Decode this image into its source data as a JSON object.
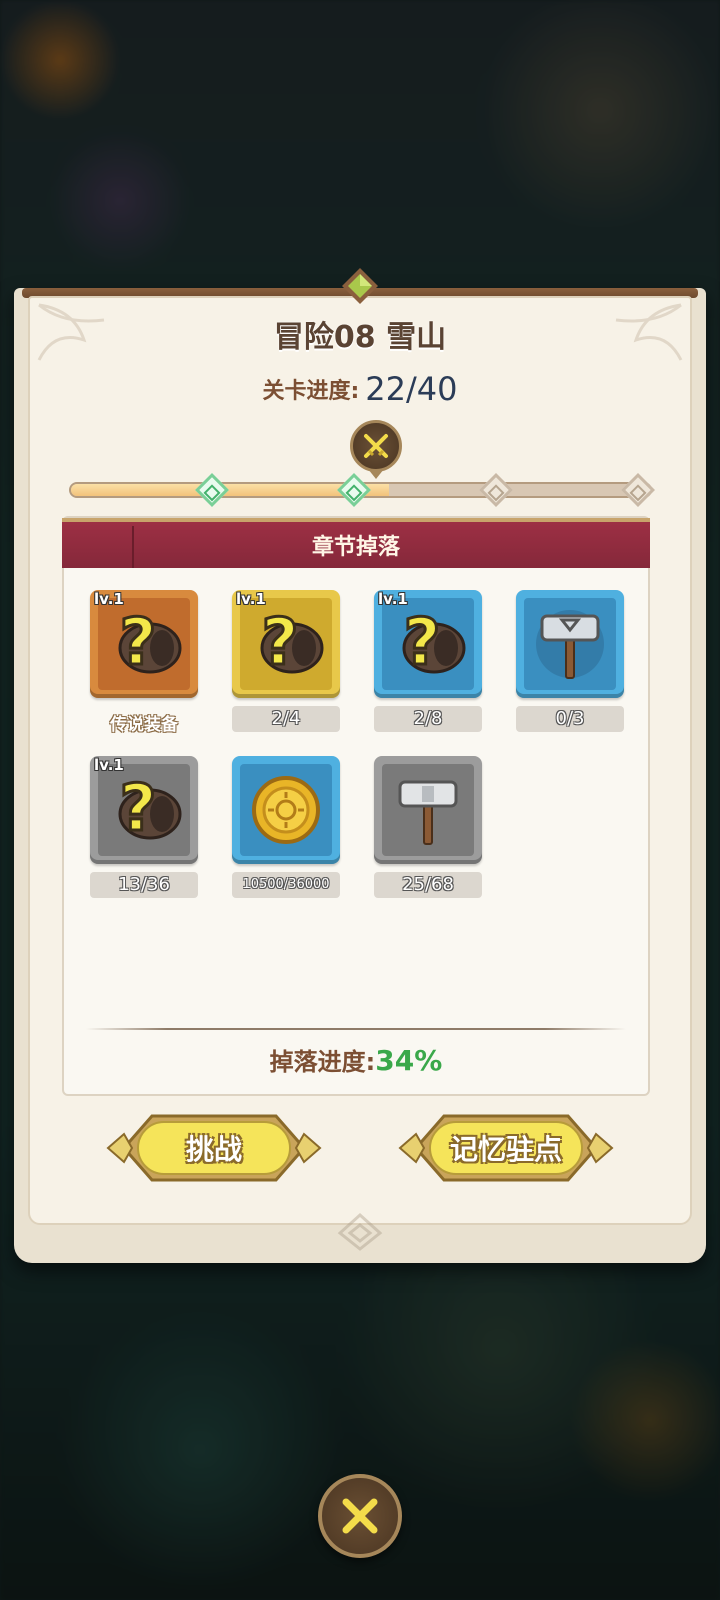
{
  "dialog": {
    "title": "冒险08 雪山",
    "stage_label": "关卡进度:",
    "stage_value": "22/40",
    "stage_progress": 0.55,
    "milestones": [
      {
        "done": true
      },
      {
        "done": true
      },
      {
        "done": false
      },
      {
        "done": false
      }
    ]
  },
  "drops": {
    "header": "章节掉落",
    "items": [
      {
        "icon": "mystery-armor-icon",
        "rarity": "legendary-orange",
        "level": "lv.1",
        "caption": "传说装备"
      },
      {
        "icon": "mystery-armor-icon",
        "rarity": "epic-gold",
        "level": "lv.1",
        "count": "2/4"
      },
      {
        "icon": "mystery-armor-icon",
        "rarity": "rare-blue",
        "level": "lv.1",
        "count": "2/8"
      },
      {
        "icon": "hammer-icon",
        "rarity": "rare-blue",
        "count": "0/3"
      },
      {
        "icon": "mystery-armor-icon",
        "rarity": "common-gray",
        "level": "lv.1",
        "count": "13/36"
      },
      {
        "icon": "gold-coin-icon",
        "rarity": "rare-blue",
        "count": "10500/36000"
      },
      {
        "icon": "hammer-icon",
        "rarity": "common-gray",
        "count": "25/68"
      }
    ],
    "progress_label": "掉落进度:",
    "progress_value": "34%"
  },
  "buttons": {
    "challenge": "挑战",
    "memory_checkpoint": "记忆驻点"
  },
  "colors": {
    "banner": "#8f2b3e",
    "progress_green": "#3aa84a",
    "title_brown": "#5a4333",
    "button_yellow": "#f5e45a"
  }
}
